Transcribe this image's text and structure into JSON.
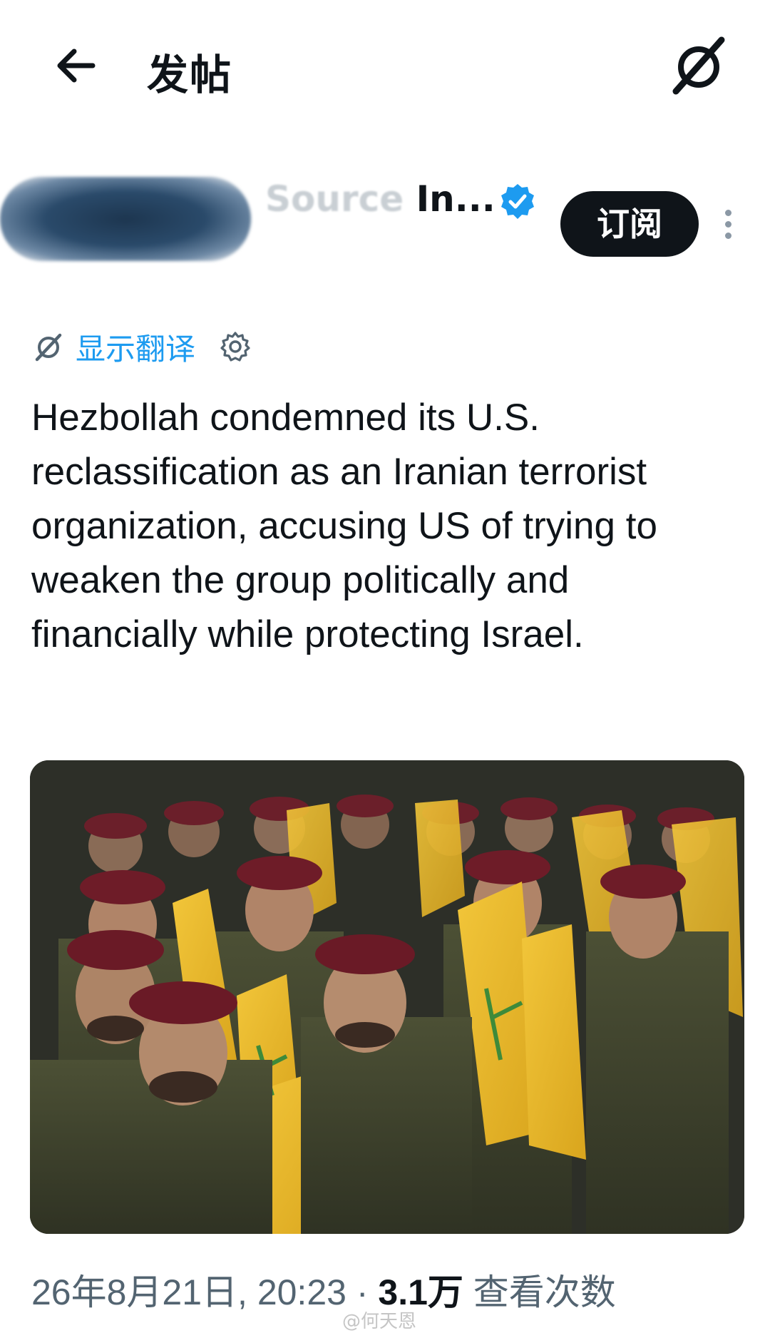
{
  "header": {
    "title": "发帖"
  },
  "author": {
    "name_visible": "In...",
    "name_faded": "Source ",
    "subscribe_label": "订阅"
  },
  "translate": {
    "label": "显示翻译"
  },
  "tweet": {
    "text": "Hezbollah condemned its U.S. reclassification as an Iranian terrorist organization, accusing US of trying to weaken the group politically and financially while protecting Israel."
  },
  "meta": {
    "timestamp": "26年8月21日, 20:23",
    "separator": " · ",
    "views_count": "3.1万",
    "views_label": " 查看次数"
  },
  "watermark": "@何天恩",
  "colors": {
    "accent": "#1d9bf0",
    "text": "#0f1419",
    "secondary": "#536471"
  },
  "icons": {
    "back": "arrow-left-icon",
    "grok": "grok-icon",
    "verified": "verified-badge-icon",
    "more": "more-vertical-icon",
    "translate": "translate-globe-icon",
    "settings": "gear-icon"
  }
}
